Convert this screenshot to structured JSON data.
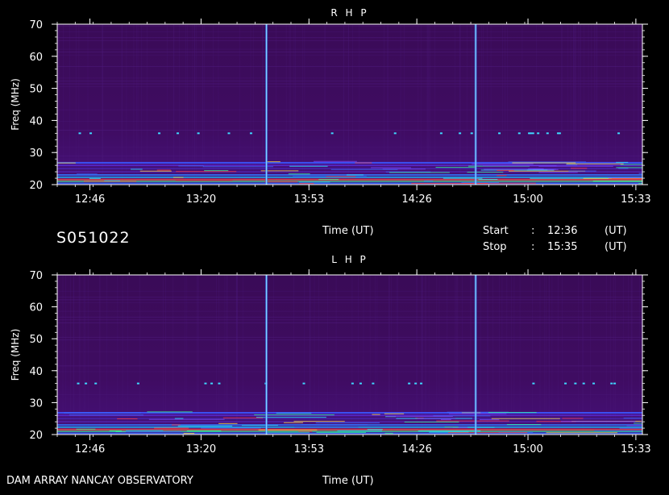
{
  "observation": {
    "id": "S051022",
    "time_label": "Time (UT)",
    "start_label": "Start",
    "start_time": "12:36",
    "stop_label": "Stop",
    "stop_time": "15:35",
    "ut_label": "(UT)",
    "colon": ":"
  },
  "footer": {
    "instrument": "DAM ARRAY  NANCAY OBSERVATORY",
    "time_label": "Time (UT)"
  },
  "colors": {
    "background": "#000000",
    "spectrogram_base": "#3d0a5c",
    "axis": "#ffffff",
    "burst_line": "#7fd4ff",
    "low_freq_band": "#2a4cff"
  },
  "chart_data": [
    {
      "type": "heatmap",
      "title": "R H P",
      "xlabel": "",
      "ylabel": "Freq (MHz)",
      "ylim": [
        20,
        70
      ],
      "xlim": [
        "12:36",
        "15:35"
      ],
      "x_ticks": [
        "12:46",
        "13:20",
        "13:53",
        "14:26",
        "15:00",
        "15:33"
      ],
      "y_ticks": [
        20,
        30,
        40,
        50,
        60,
        70
      ],
      "vertical_bursts": [
        "13:40",
        "14:44"
      ],
      "dotted_feature_freq": 36,
      "intense_band_freq": [
        20,
        27
      ]
    },
    {
      "type": "heatmap",
      "title": "L H P",
      "xlabel": "",
      "ylabel": "Freq (MHz)",
      "ylim": [
        20,
        70
      ],
      "xlim": [
        "12:36",
        "15:35"
      ],
      "x_ticks": [
        "12:46",
        "13:20",
        "13:53",
        "14:26",
        "15:00",
        "15:33"
      ],
      "y_ticks": [
        20,
        30,
        40,
        50,
        60,
        70
      ],
      "vertical_bursts": [
        "13:40",
        "14:44"
      ],
      "dotted_feature_freq": 36,
      "intense_band_freq": [
        20,
        27
      ]
    }
  ]
}
